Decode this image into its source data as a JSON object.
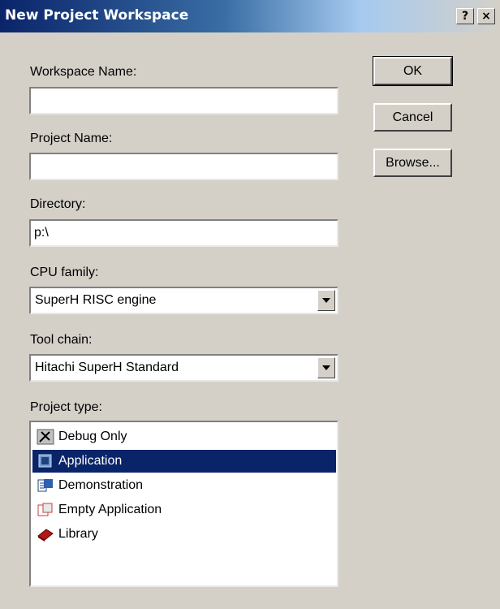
{
  "window": {
    "title": "New Project Workspace",
    "help_label": "?",
    "close_label": "×"
  },
  "form": {
    "workspace_name": {
      "label": "Workspace Name:",
      "value": ""
    },
    "project_name": {
      "label": "Project Name:",
      "value": ""
    },
    "directory": {
      "label": "Directory:",
      "value": "p:\\"
    },
    "cpu_family": {
      "label": "CPU family:",
      "value": "SuperH RISC engine"
    },
    "tool_chain": {
      "label": "Tool chain:",
      "value": "Hitachi SuperH Standard"
    },
    "project_type": {
      "label": "Project type:",
      "selected_index": 1,
      "items": [
        {
          "label": "Debug Only",
          "icon": "debug-only-icon"
        },
        {
          "label": "Application",
          "icon": "application-icon"
        },
        {
          "label": "Demonstration",
          "icon": "demonstration-icon"
        },
        {
          "label": "Empty Application",
          "icon": "empty-application-icon"
        },
        {
          "label": "Library",
          "icon": "library-icon"
        }
      ]
    }
  },
  "buttons": {
    "ok": "OK",
    "cancel": "Cancel",
    "browse": "Browse..."
  },
  "colors": {
    "title_bar": "#0a246a",
    "face": "#d4d0c8",
    "selection": "#0a246a"
  }
}
